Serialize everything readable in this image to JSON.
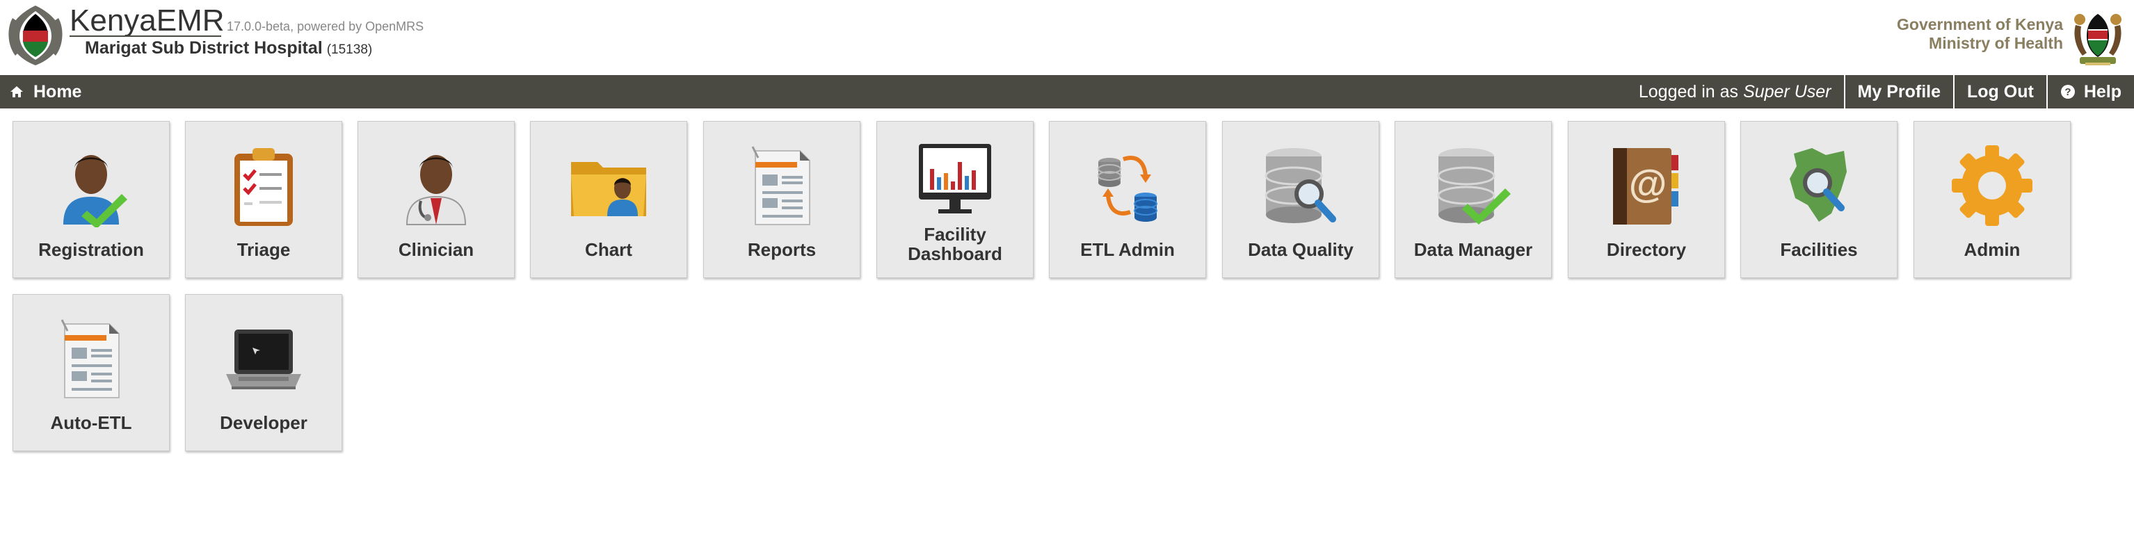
{
  "header": {
    "app_name": "KenyaEMR",
    "version": "17.0.0-beta, powered by OpenMRS",
    "facility_name": "Marigat Sub District Hospital",
    "facility_code": "(15138)",
    "gov_line1": "Government of Kenya",
    "gov_line2": "Ministry of Health"
  },
  "nav": {
    "home": "Home",
    "logged_in_prefix": "Logged in as",
    "user": "Super User",
    "my_profile": "My Profile",
    "log_out": "Log Out",
    "help": "Help",
    "bar_color": "#4a4a42"
  },
  "apps": [
    {
      "label": "Registration",
      "icon": "patient-check-icon"
    },
    {
      "label": "Triage",
      "icon": "clipboard-icon"
    },
    {
      "label": "Clinician",
      "icon": "doctor-icon"
    },
    {
      "label": "Chart",
      "icon": "folder-icon"
    },
    {
      "label": "Reports",
      "icon": "report-icon"
    },
    {
      "label": "Facility Dashboard",
      "icon": "monitor-chart-icon"
    },
    {
      "label": "ETL Admin",
      "icon": "database-sync-icon"
    },
    {
      "label": "Data Quality",
      "icon": "database-search-icon"
    },
    {
      "label": "Data Manager",
      "icon": "database-check-icon"
    },
    {
      "label": "Directory",
      "icon": "address-book-icon"
    },
    {
      "label": "Facilities",
      "icon": "map-search-icon"
    },
    {
      "label": "Admin",
      "icon": "gear-icon"
    },
    {
      "label": "Auto-ETL",
      "icon": "report-icon"
    },
    {
      "label": "Developer",
      "icon": "laptop-icon"
    }
  ]
}
